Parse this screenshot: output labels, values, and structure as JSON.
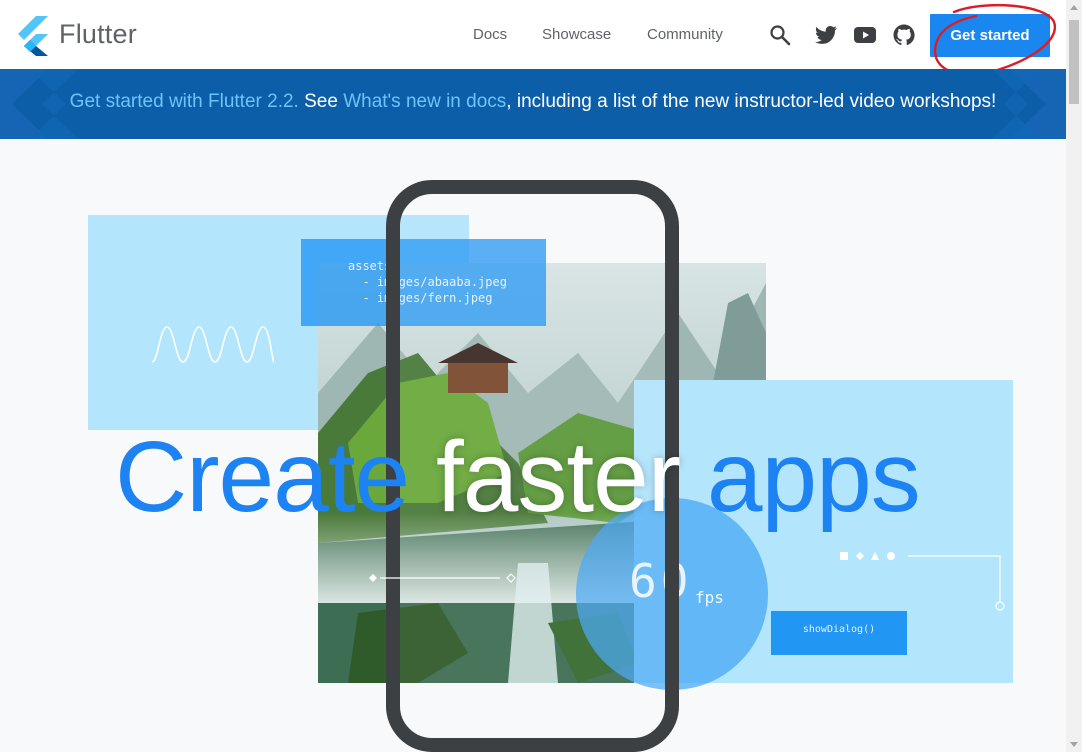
{
  "header": {
    "brand": "Flutter",
    "nav": [
      "Docs",
      "Showcase",
      "Community"
    ],
    "icons": [
      "search-icon",
      "twitter-icon",
      "youtube-icon",
      "github-icon"
    ],
    "cta_label": "Get started"
  },
  "banner": {
    "link1": "Get started with Flutter 2.2.",
    "text1": " See ",
    "link2": "What's new in docs",
    "text2": ", including a list of the new instructor-led video workshops!"
  },
  "hero": {
    "code_lines": [
      "assets:",
      "  - images/abaaba.jpeg",
      "  - images/fern.jpeg"
    ],
    "fps_value": "60",
    "fps_unit": "fps",
    "dialog_label": "showDialog()",
    "headline_1": "Create",
    "headline_2": "faster",
    "headline_3": "apps"
  },
  "colors": {
    "accent": "#1a86f0",
    "banner_bg": "#0d5ea8",
    "banner_link": "#6ac5fa",
    "panel_light": "#b3e5fc",
    "headline_blue": "#1d82f2"
  }
}
